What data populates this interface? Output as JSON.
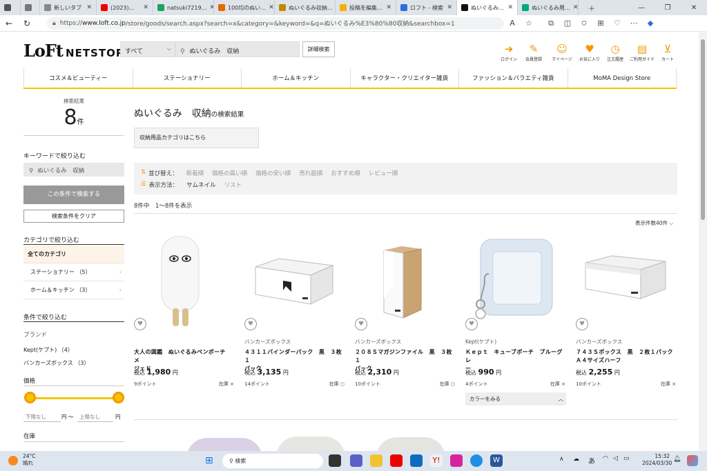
{
  "browser": {
    "tabs": [
      {
        "label": "",
        "color": "#555"
      },
      {
        "label": "新しいタブ",
        "color": "#888"
      },
      {
        "label": "(2023)…",
        "color": "#e00"
      },
      {
        "label": "natsuki7219…",
        "color": "#1aa260"
      },
      {
        "label": "100均のぬい…",
        "color": "#e26a00"
      },
      {
        "label": "ぬいぐるみ収納…",
        "color": "#c28800"
      },
      {
        "label": "投稿を編集…",
        "color": "#f0b400"
      },
      {
        "label": "ロフト - 検索",
        "color": "#2d6cdf"
      },
      {
        "label": "ぬいぐるみ…",
        "color": "#111"
      },
      {
        "label": "ぬいぐるみ用…",
        "color": "#0a7"
      }
    ],
    "url_prefix": "https://",
    "url_host": "www.loft.co.jp",
    "url_path": "/store/goods/search.aspx?search=x&category=&keyword=&q=ぬいぐるみ%E3%80%80収納&searchbox=1"
  },
  "header": {
    "logo_loft": "LoFt",
    "logo_net": "NETSTORE",
    "category_select": "すべて",
    "search_value": "ぬいぐるみ　収納",
    "detail_search": "詳細検索",
    "icons": [
      {
        "label": "ログイン",
        "glyph": "➜"
      },
      {
        "label": "会員登録",
        "glyph": "✎"
      },
      {
        "label": "マイページ",
        "glyph": "☺"
      },
      {
        "label": "お気に入り",
        "glyph": "♥"
      },
      {
        "label": "注文履歴",
        "glyph": "◷"
      },
      {
        "label": "ご利用ガイド",
        "glyph": "▤"
      },
      {
        "label": "カート",
        "glyph": "⊻"
      }
    ]
  },
  "nav": [
    "コスメ＆ビューティー",
    "ステーショナリー",
    "ホーム＆キッチン",
    "キャラクター・クリエイター雑貨",
    "ファッション＆バラエティ雑貨",
    "MoMA Design Store"
  ],
  "sidebar": {
    "result_label": "検索結果",
    "result_count": "8",
    "result_unit": "件",
    "keyword_title": "キーワードで絞り込む",
    "keyword_value": "ぬいぐるみ　収納",
    "apply_button": "この条件で検索する",
    "clear_button": "検索条件をクリア",
    "category_title": "カテゴリで絞り込む",
    "categories": [
      {
        "label": "全てのカテゴリ"
      },
      {
        "label": "ステーショナリー （5）"
      },
      {
        "label": "ホーム＆キッチン （3）"
      }
    ],
    "filter_title": "条件で絞り込む",
    "brand_title": "ブランド",
    "brands": [
      "Kept(ケプト) （4）",
      "バンカーズボックス （3）"
    ],
    "price_title": "価格",
    "price_min_placeholder": "下限なし",
    "price_max_placeholder": "上限なし",
    "price_unit": "円",
    "price_sep": "円 〜",
    "stock_title": "在庫"
  },
  "main": {
    "title_keyword": "ぬいぐるみ　収納",
    "title_suffix": "の検索結果",
    "category_link": "収納用品カテゴリはこちら",
    "sort_label": "並び替え：",
    "sort_options": [
      "新着順",
      "価格の高い順",
      "価格の安い順",
      "売れ筋順",
      "おすすめ順",
      "レビュー順"
    ],
    "view_label": "表示方法：",
    "view_options": [
      "サムネイル",
      "リスト"
    ],
    "count_total": "8件中",
    "count_range": "1〜8件を表示",
    "per_page": "表示件数40件"
  },
  "products": [
    {
      "brand": "",
      "name_lines": [
        "大人の図鑑　ぬいぐるみペンポーチ　メ",
        "ジェド"
      ],
      "price_prefix": "税込",
      "price": "1,980",
      "price_unit": "円",
      "points": "9ポイント",
      "stock": "在庫 ×"
    },
    {
      "brand": "バンカーズボックス",
      "name_lines": [
        "４３１１バインダーパック　黒　３枚１",
        "パック"
      ],
      "price_prefix": "税込",
      "price": "3,135",
      "price_unit": "円",
      "points": "14ポイント",
      "stock": "在庫 ○"
    },
    {
      "brand": "バンカーズボックス",
      "name_lines": [
        "２０８Ｓマガジンファイル　黒　３枚１",
        "パック"
      ],
      "price_prefix": "税込",
      "price": "2,310",
      "price_unit": "円",
      "points": "10ポイント",
      "stock": "在庫 ○"
    },
    {
      "brand": "Kept(ケプト)",
      "name_lines": [
        "Ｋｅｐｔ　キューブポーチ　ブルーグレ",
        "ー"
      ],
      "price_prefix": "税込",
      "price": "990",
      "price_unit": "円",
      "points": "4ポイント",
      "stock": "在庫 ×",
      "color_button": "カラーをみる"
    },
    {
      "brand": "バンカーズボックス",
      "name_lines": [
        "７４３Ｓボックス　黒　２枚１パック",
        "Ａ４サイズハーフ"
      ],
      "price_prefix": "税込",
      "price": "2,255",
      "price_unit": "円",
      "points": "10ポイント",
      "stock": "在庫 ×"
    }
  ],
  "taskbar": {
    "weather_temp": "24°C",
    "weather_text": "晴れ",
    "search_label": "検索",
    "ime": "あ",
    "time": "15:32",
    "date": "2024/03/30"
  }
}
